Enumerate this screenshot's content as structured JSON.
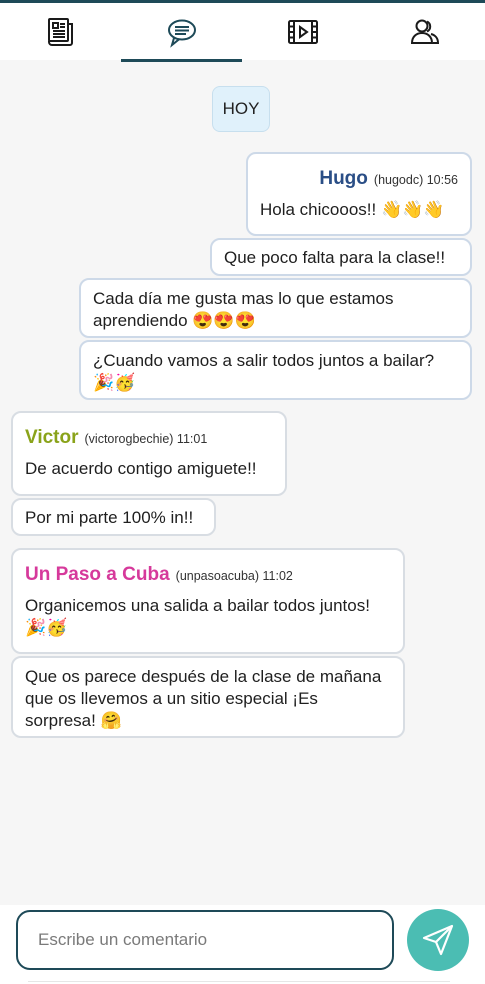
{
  "tabs": [
    {
      "icon": "newspaper-icon"
    },
    {
      "icon": "chat-icon",
      "active": true
    },
    {
      "icon": "video-icon"
    },
    {
      "icon": "people-icon"
    }
  ],
  "date_chip": "HOY",
  "colors": {
    "accent": "#1e4a58",
    "send_button": "#4bbdb3",
    "hugo": "#2a4e86",
    "victor": "#8aa31a",
    "unpasoacuba": "#d6399b"
  },
  "messages": {
    "hugo": {
      "name": "Hugo",
      "meta": "(hugodc) 10:56",
      "m1": "Hola chicooos!! 👋👋👋",
      "m2": "Que poco falta para la clase!!",
      "m3": "Cada día me gusta mas lo que estamos aprendiendo 😍😍😍",
      "m4": "¿Cuando vamos a salir todos juntos a bailar? 🎉🥳"
    },
    "victor": {
      "name": "Victor",
      "meta": "(victorogbechie) 11:01",
      "m1": "De acuerdo contigo amiguete!!",
      "m2": "Por mi parte 100% in!!"
    },
    "cuba": {
      "name": "Un Paso a Cuba",
      "meta": "(unpasoacuba) 11:02",
      "m1": "Organicemos una salida a bailar todos juntos! 🎉🥳",
      "m2": "Que os parece después de la clase de mañana que os llevemos a un sitio especial ¡Es sorpresa! 🤗"
    }
  },
  "composer": {
    "placeholder": "Escribe un comentario"
  }
}
